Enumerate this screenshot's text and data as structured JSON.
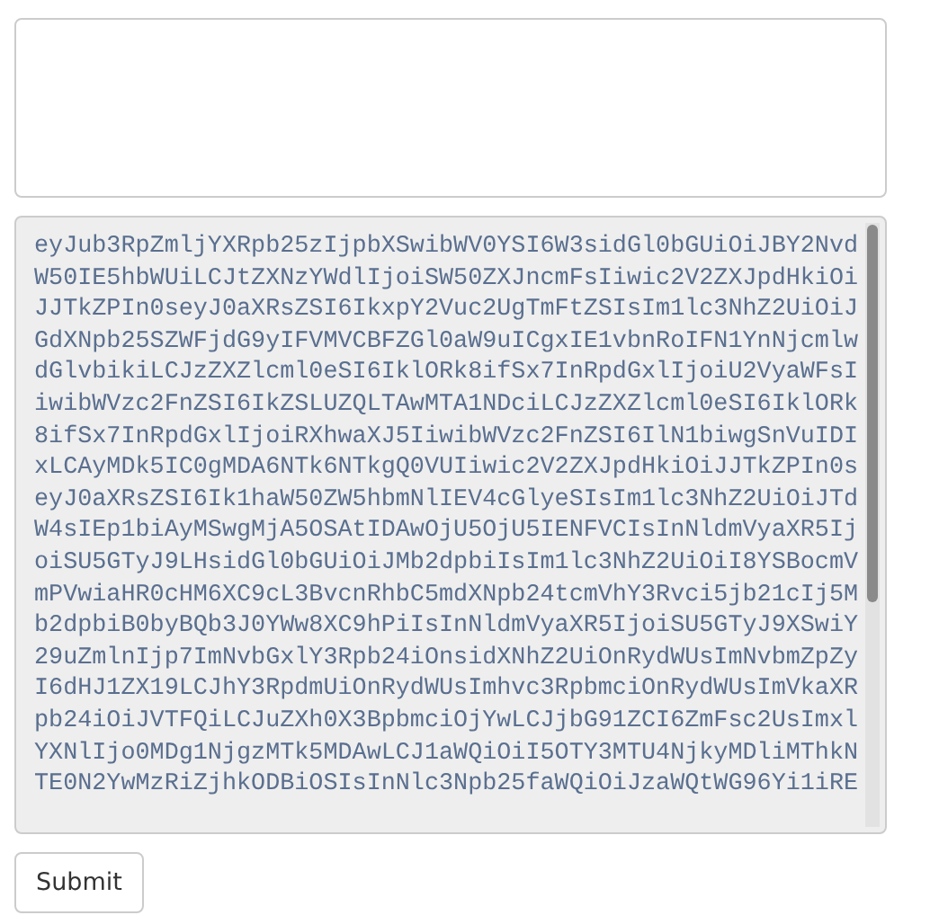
{
  "code_field": {
    "lines": [
      "eyJub3RpZmljYXRpb25zIjpbXSwibWV0YSI6W3sidGl0bGUiOiJBY2Nvd",
      "W50IE5hbWUiLCJtZXNzYWdlIjoiSW50ZXJncmFsIiwic2V2ZXJpdHkiOi",
      "JJTkZPIn0seyJ0aXRsZSI6IkxpY2Vuc2UgTmFtZSIsIm1lc3NhZ2UiOiJ",
      "GdXNpb25SZWFjdG9yIFVMVCBFZGl0aW9uICgxIE1vbnRoIFN1YnNjcmlw",
      "dGlvbikiLCJzZXZlcml0eSI6IklORk8ifSx7InRpdGxlIjoiU2VyaWFsI",
      "iwibWVzc2FnZSI6IkZSLUZQLTAwMTA1NDciLCJzZXZlcml0eSI6IklORk",
      "8ifSx7InRpdGxlIjoiRXhwaXJ5IiwibWVzc2FnZSI6IlN1biwgSnVuIDI",
      "xLCAyMDk5IC0gMDA6NTk6NTkgQ0VUIiwic2V2ZXJpdHkiOiJJTkZPIn0s",
      "eyJ0aXRsZSI6Ik1haW50ZW5hbmNlIEV4cGlyeSIsIm1lc3NhZ2UiOiJTd",
      "W4sIEp1biAyMSwgMjA5OSAtIDAwOjU5OjU5IENFVCIsInNldmVyaXR5Ij",
      "oiSU5GTyJ9LHsidGl0bGUiOiJMb2dpbiIsIm1lc3NhZ2UiOiI8YSBocmV",
      "mPVwiaHR0cHM6XC9cL3BvcnRhbC5mdXNpb24tcmVhY3Rvci5jb21cIj5M",
      "b2dpbiB0byBQb3J0YWw8XC9hPiIsInNldmVyaXR5IjoiSU5GTyJ9XSwiY",
      "29uZmlnIjp7ImNvbGxlY3Rpb24iOnsidXNhZ2UiOnRydWUsImNvbmZpZy",
      "I6dHJ1ZX19LCJhY3RpdmUiOnRydWUsImhvc3RpbmciOnRydWUsImVkaXR",
      "pb24iOiJVTFQiLCJuZXh0X3BpbmciOjYwLCJjbG91ZCI6ZmFsc2UsImxl",
      "YXNlIjo0MDg1NjgzMTk5MDAwLCJ1aWQiOiI5OTY3MTU4NjkyMDliMThkN",
      "TE0N2YwMzRiZjhkODBiOSIsInNlc3Npb25faWQiOiJzaWQtWG96Yi1iRE"
    ]
  },
  "submit_button": {
    "label": "Submit"
  }
}
